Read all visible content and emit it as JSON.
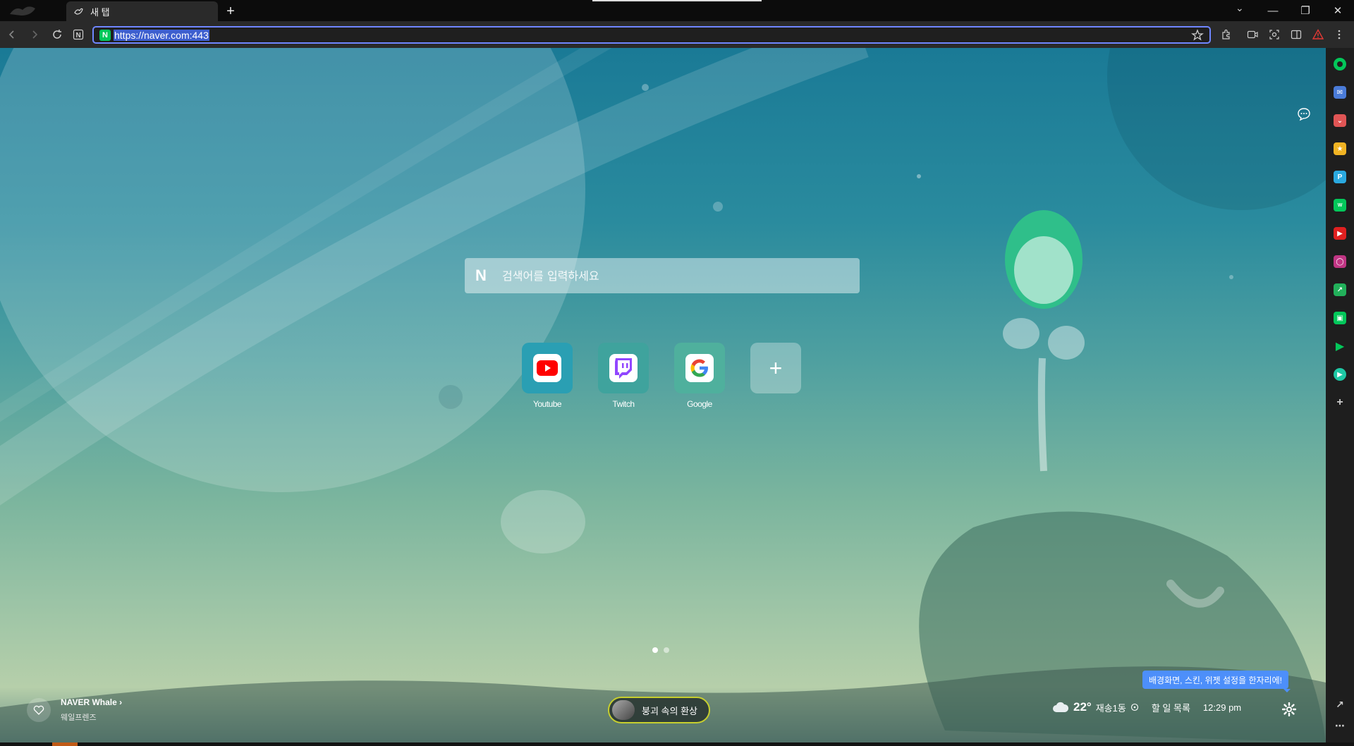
{
  "browser": {
    "tab_title": "새 탭",
    "url": "https://naver.com:443",
    "site_badge": "N",
    "colors": {
      "omnibox_border": "#6f86ff",
      "naver_green": "#03c75a"
    }
  },
  "search": {
    "logo": "N",
    "placeholder": "검색어를 입력하세요"
  },
  "shortcuts": [
    {
      "label": "Youtube",
      "icon": "youtube-icon",
      "tile_color": "#2a9fb3"
    },
    {
      "label": "Twitch",
      "icon": "twitch-icon",
      "tile_color": "#3fa39d"
    },
    {
      "label": "Google",
      "icon": "google-icon",
      "tile_color": "#4fb09d"
    }
  ],
  "add_shortcut_symbol": "+",
  "friend_card": {
    "title": "NAVER Whale",
    "subtitle": "웨일프렌즈"
  },
  "theme_pill": {
    "label": "붕괴 속의 환상"
  },
  "widgets": {
    "temperature": "22°",
    "location": "재송1동",
    "todo": "할 일 목록",
    "time": "12:29 pm",
    "tooltip": "배경화면, 스킨, 위젯 설정을 한자리에!"
  },
  "sidebar_icons": [
    {
      "name": "whale-space-icon",
      "color": "#03c75a"
    },
    {
      "name": "mail-icon",
      "color": "#4a7bd8"
    },
    {
      "name": "pocket-icon",
      "color": "#e05555"
    },
    {
      "name": "bookmark-star-icon",
      "color": "#f0b323"
    },
    {
      "name": "papago-icon",
      "color": "#2aa9e0"
    },
    {
      "name": "webtoon-icon",
      "color": "#03c75a"
    },
    {
      "name": "youtube-sidebar-icon",
      "color": "#e02020"
    },
    {
      "name": "instagram-icon",
      "color": "#c13584"
    },
    {
      "name": "stock-icon",
      "color": "#22b05a"
    },
    {
      "name": "calendar-icon",
      "color": "#03c75a"
    },
    {
      "name": "play-icon",
      "color": "#03c75a"
    },
    {
      "name": "music-icon",
      "color": "#1ec8a5"
    }
  ]
}
